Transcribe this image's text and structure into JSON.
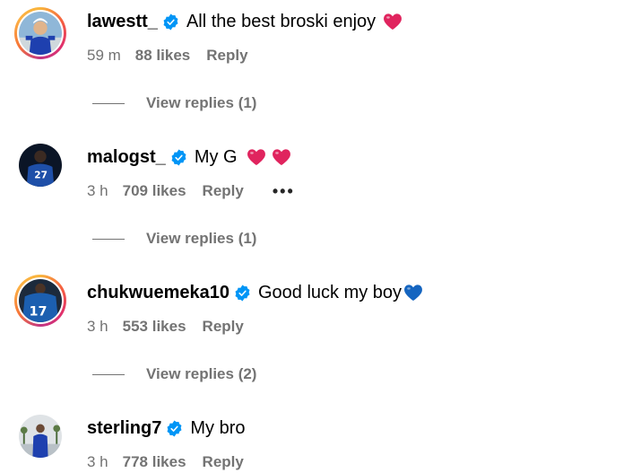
{
  "comments": [
    {
      "username": "lawestt_",
      "text": "All the best broski enjoy",
      "emoji": [
        "red-heart"
      ],
      "time": "59 m",
      "likes": "88 likes",
      "reply_label": "Reply",
      "view_replies": "View replies (1)",
      "avatar_ring": "story"
    },
    {
      "username": "malogst_",
      "text": "My G",
      "emoji": [
        "red-heart",
        "red-heart"
      ],
      "time": "3 h",
      "likes": "709 likes",
      "reply_label": "Reply",
      "more_label": "•••",
      "view_replies": "View replies (1)",
      "avatar_ring": "none"
    },
    {
      "username": "chukwuemeka10",
      "text": "Good luck my boy",
      "emoji": [
        "blue-heart"
      ],
      "time": "3 h",
      "likes": "553 likes",
      "reply_label": "Reply",
      "view_replies": "View replies (2)",
      "avatar_ring": "story"
    },
    {
      "username": "sterling7",
      "text": "My bro",
      "emoji": [],
      "time": "3 h",
      "likes": "778 likes",
      "reply_label": "Reply",
      "avatar_ring": "none"
    }
  ],
  "colors": {
    "verified_badge": "#0095f6",
    "red_heart": "#e0245e",
    "blue_heart": "#1565c0",
    "secondary_text": "#737373"
  }
}
